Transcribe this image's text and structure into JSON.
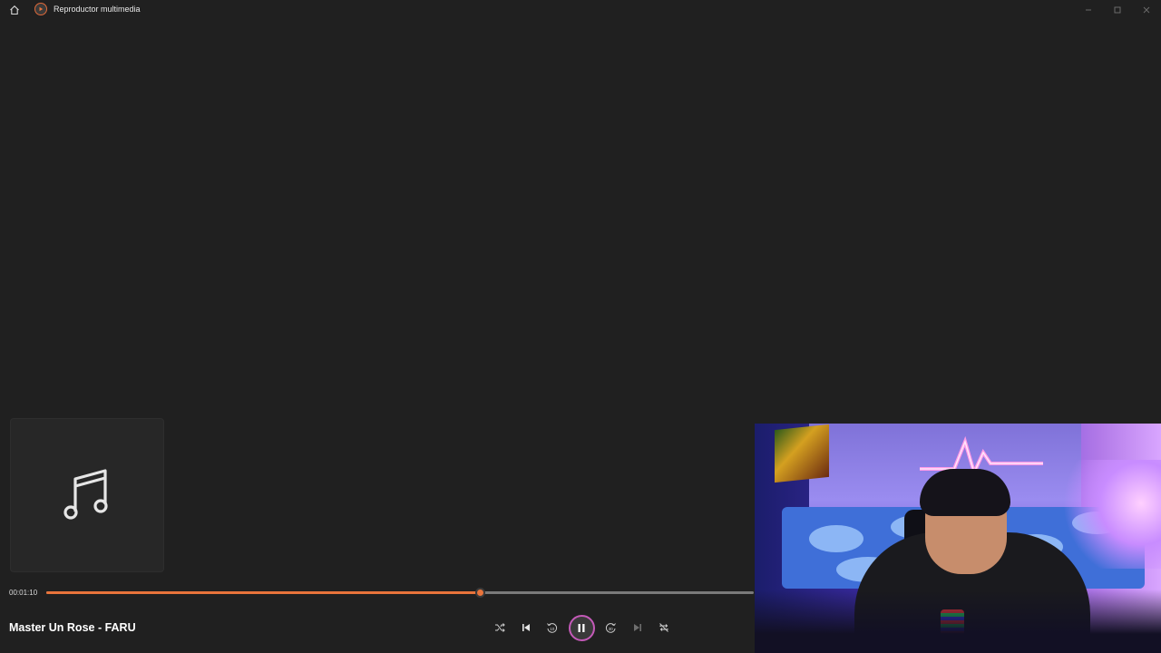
{
  "titlebar": {
    "app_title": "Reproductor multimedia",
    "home_icon": "home-icon",
    "app_icon": "media-player-icon",
    "minimize_icon": "minimize-icon",
    "maximize_icon": "maximize-icon",
    "close_icon": "close-icon"
  },
  "album_art": {
    "icon": "music-note-icon"
  },
  "player": {
    "time_elapsed": "00:01:10",
    "progress_fraction": 0.613,
    "song_title": "Master Un Rose - FARU"
  },
  "controls": [
    {
      "name": "shuffle-button",
      "icon": "shuffle-icon"
    },
    {
      "name": "previous-button",
      "icon": "previous-icon"
    },
    {
      "name": "rewind-10-button",
      "icon": "rewind-10-icon",
      "label": "10"
    },
    {
      "name": "play-pause-button",
      "icon": "pause-icon"
    },
    {
      "name": "forward-30-button",
      "icon": "forward-30-icon",
      "label": "30"
    },
    {
      "name": "next-button",
      "icon": "next-icon"
    },
    {
      "name": "repeat-button",
      "icon": "repeat-off-icon"
    }
  ],
  "colors": {
    "background": "#202020",
    "accent": "#e9743b",
    "play_ring": "#c45ab8",
    "track": "#7a7a7a"
  },
  "webcam": {
    "content": "webcam-overlay"
  }
}
